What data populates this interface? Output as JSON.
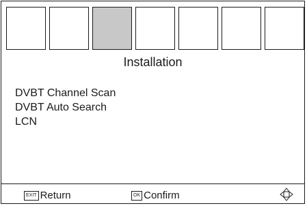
{
  "tiles": [
    {
      "selected": false
    },
    {
      "selected": false
    },
    {
      "selected": true
    },
    {
      "selected": false
    },
    {
      "selected": false
    },
    {
      "selected": false
    },
    {
      "selected": false
    }
  ],
  "title": "Installation",
  "menu": [
    {
      "label": "DVBT Channel Scan"
    },
    {
      "label": "DVBT Auto Search"
    },
    {
      "label": "LCN"
    }
  ],
  "footer": {
    "return_key": "EXIT",
    "return_label": "Return",
    "confirm_key": "OK",
    "confirm_label": "Confirm",
    "nav_icon": "navigation-arrows-icon"
  },
  "colors": {
    "selected_tile": "#c8c8c8",
    "border": "#1a1a1a"
  }
}
